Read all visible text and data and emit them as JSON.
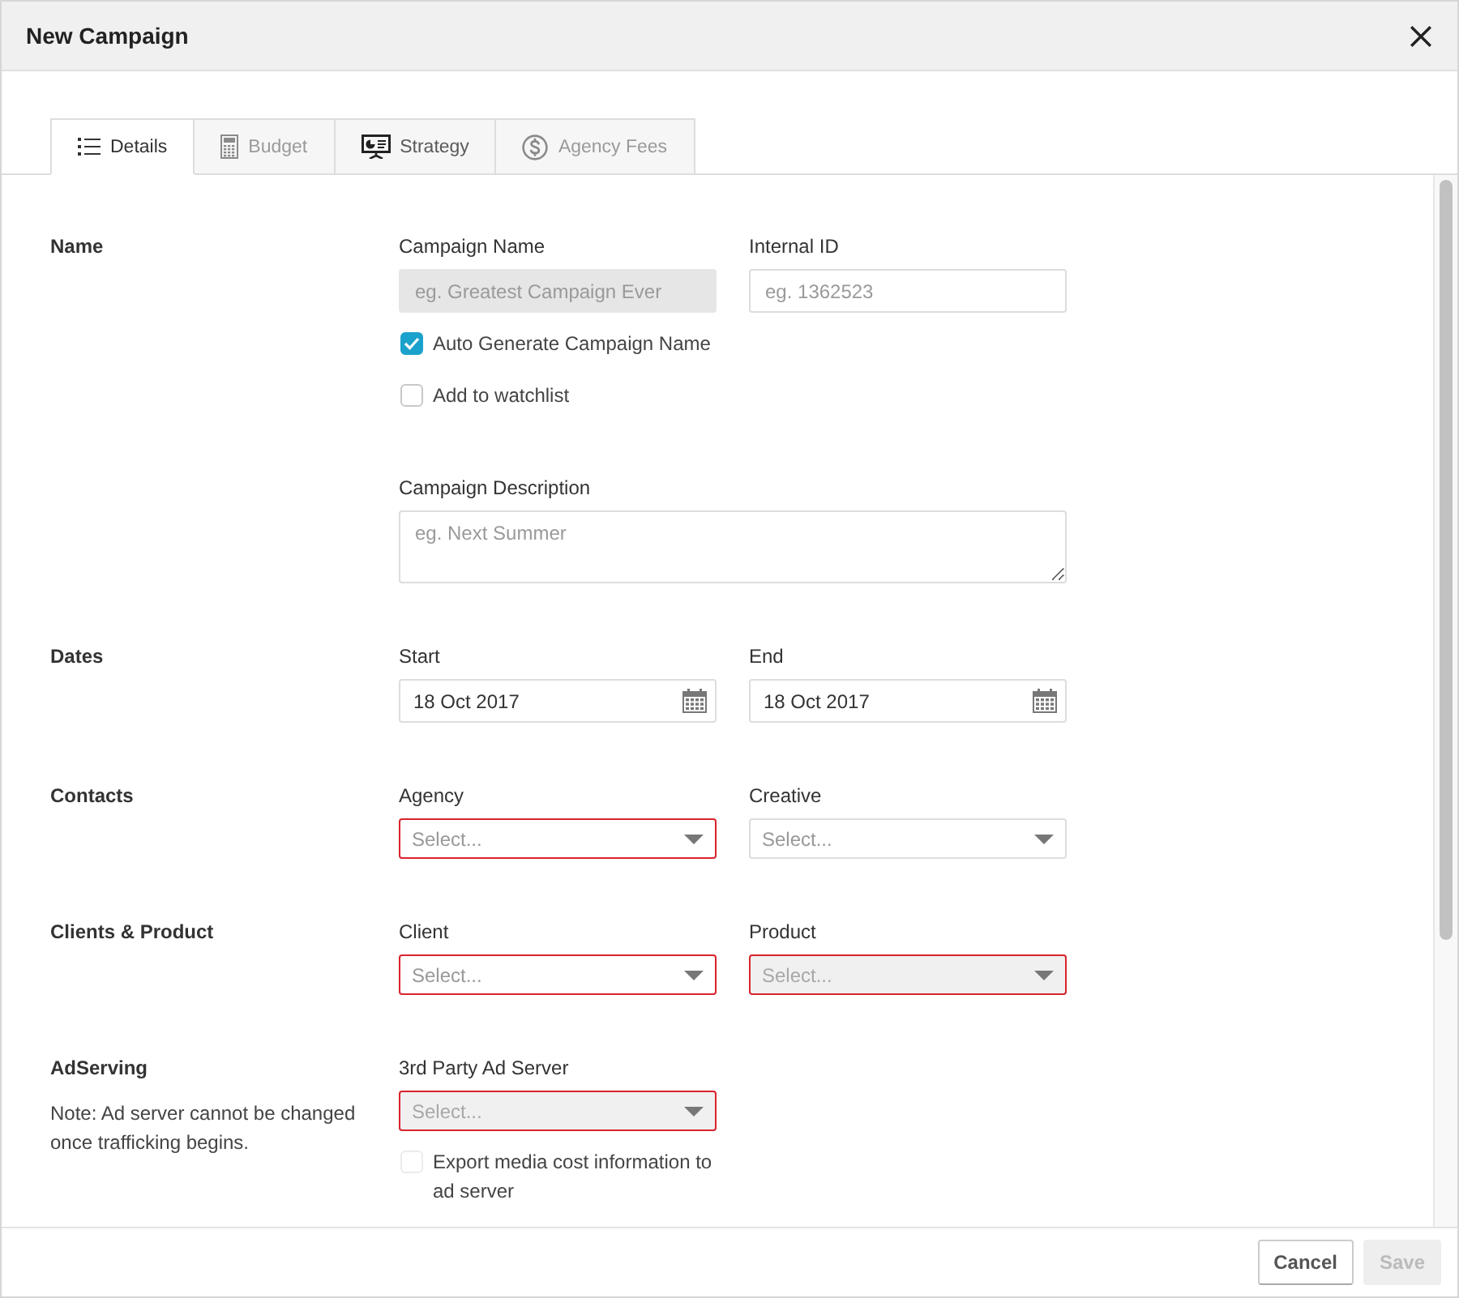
{
  "window": {
    "title": "New Campaign"
  },
  "tabs": [
    {
      "label": "Details",
      "selected": true,
      "disabled": false
    },
    {
      "label": "Budget",
      "selected": false,
      "disabled": true
    },
    {
      "label": "Strategy",
      "selected": false,
      "disabled": false
    },
    {
      "label": "Agency Fees",
      "selected": false,
      "disabled": true
    }
  ],
  "sections": [
    {
      "title": "Name",
      "items": [
        {
          "kind": "fields",
          "fields": [
            {
              "kind": "text",
              "label": "Campaign Name",
              "placeholder": "eg. Greatest Campaign Ever",
              "disabled": true,
              "error": false
            },
            {
              "kind": "text",
              "label": "Internal ID",
              "placeholder": "eg. 1362523",
              "disabled": false,
              "error": false
            }
          ]
        },
        {
          "kind": "checkbox",
          "label": "Auto Generate Campaign Name",
          "checked": true,
          "disabled": false
        },
        {
          "kind": "checkbox",
          "label": "Add to watchlist",
          "checked": false,
          "disabled": false
        },
        {
          "kind": "fields",
          "fields": [
            {
              "kind": "textarea",
              "label": "Campaign Description",
              "placeholder": "eg. Next Summer",
              "disabled": false,
              "error": false
            }
          ]
        }
      ]
    },
    {
      "title": "Dates",
      "items": [
        {
          "kind": "fields",
          "fields": [
            {
              "kind": "date",
              "label": "Start",
              "value": "18 Oct 2017",
              "disabled": false,
              "error": false
            },
            {
              "kind": "date",
              "label": "End",
              "value": "18 Oct 2017",
              "disabled": false,
              "error": false
            }
          ]
        }
      ]
    },
    {
      "title": "Contacts",
      "items": [
        {
          "kind": "fields",
          "fields": [
            {
              "kind": "select",
              "label": "Agency",
              "placeholder": "Select...",
              "disabled": false,
              "error": true
            },
            {
              "kind": "select",
              "label": "Creative",
              "placeholder": "Select...",
              "disabled": false,
              "error": false
            }
          ]
        }
      ]
    },
    {
      "title": "Clients & Product",
      "items": [
        {
          "kind": "fields",
          "fields": [
            {
              "kind": "select",
              "label": "Client",
              "placeholder": "Select...",
              "disabled": false,
              "error": true
            },
            {
              "kind": "select",
              "label": "Product",
              "placeholder": "Select...",
              "disabled": true,
              "error": true
            }
          ]
        }
      ]
    },
    {
      "title": "AdServing",
      "note": "Note: Ad server cannot be changed once trafficking begins.",
      "items": [
        {
          "kind": "fields",
          "fields": [
            {
              "kind": "select",
              "label": "3rd Party Ad Server",
              "placeholder": "Select...",
              "disabled": true,
              "error": true
            }
          ]
        },
        {
          "kind": "checkbox",
          "label": "Export media cost information to ad server",
          "checked": false,
          "disabled": true
        }
      ]
    }
  ],
  "footer": {
    "buttons": [
      {
        "label": "Cancel",
        "disabled": false
      },
      {
        "label": "Save",
        "disabled": true
      }
    ]
  }
}
